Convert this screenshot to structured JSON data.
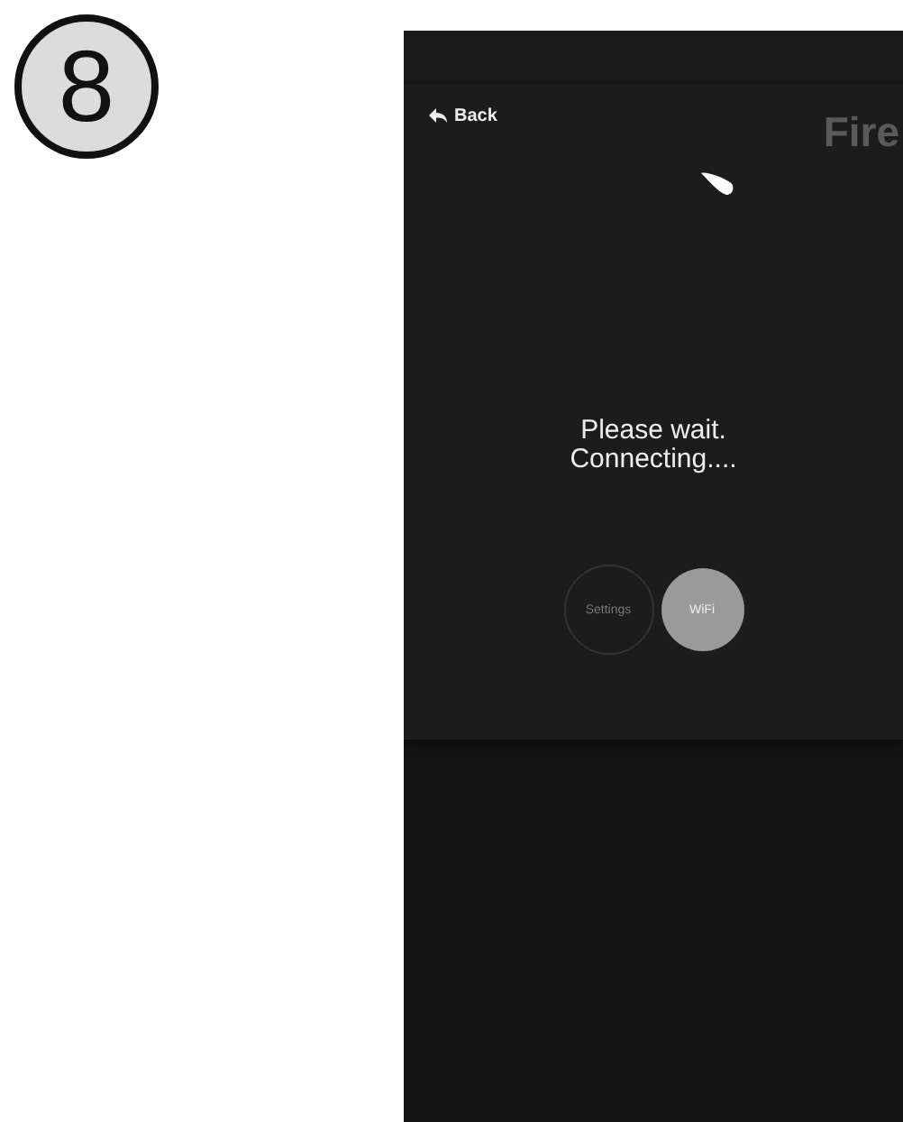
{
  "step": {
    "number": "8"
  },
  "screen": {
    "back": {
      "label": "Back"
    },
    "title": "Fire",
    "message": [
      "Please wait.",
      "Connecting...."
    ],
    "modes": [
      {
        "label": "Settings",
        "selected": false
      },
      {
        "label": "WiFi",
        "selected": true
      }
    ]
  }
}
